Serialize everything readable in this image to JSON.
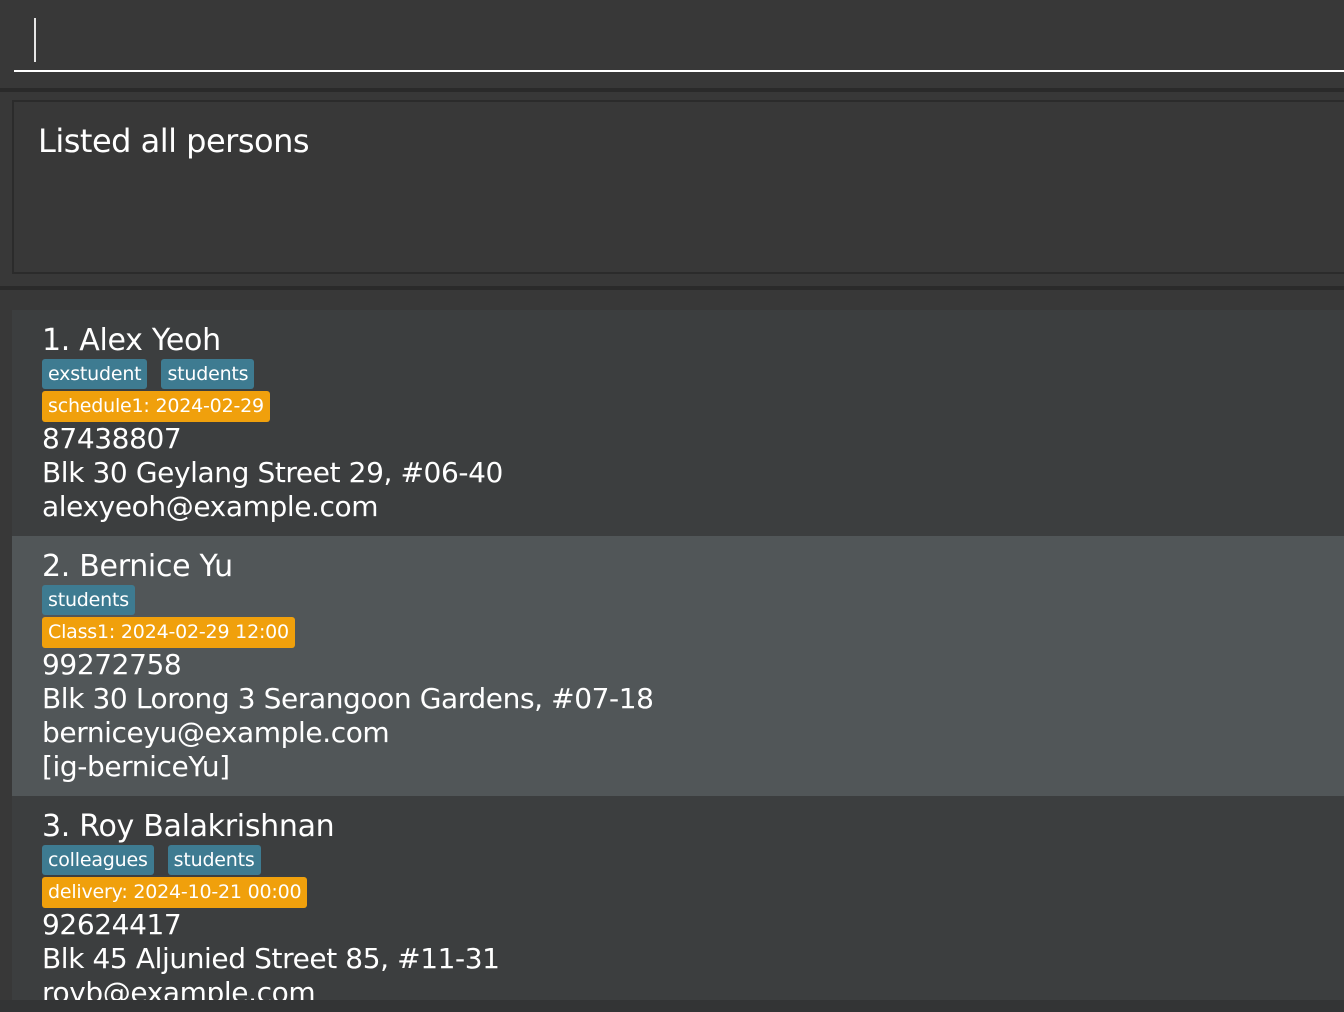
{
  "command_box": {
    "value": "",
    "placeholder": ""
  },
  "result_display": {
    "message": "Listed all persons"
  },
  "persons": [
    {
      "index_name": "1. Alex Yeoh",
      "tags": [
        "exstudent",
        "students"
      ],
      "schedule": "schedule1: 2024-02-29",
      "phone": "87438807",
      "address": "Blk 30 Geylang Street 29, #06-40",
      "email": "alexyeoh@example.com"
    },
    {
      "index_name": "2. Bernice Yu",
      "tags": [
        "students"
      ],
      "schedule": "Class1: 2024-02-29 12:00",
      "phone": "99272758",
      "address": "Blk 30 Lorong 3 Serangoon Gardens, #07-18",
      "email": "berniceyu@example.com",
      "social": "[ig-berniceYu]"
    },
    {
      "index_name": "3. Roy Balakrishnan",
      "tags": [
        "colleagues",
        "students"
      ],
      "schedule": "delivery: 2024-10-21 00:00",
      "phone": "92624417",
      "address": "Blk 45 Aljunied Street 85, #11-31",
      "email": "royb@example.com"
    }
  ],
  "colors": {
    "background": "#383838",
    "card_odd": "#3c3e3f",
    "card_selected": "#515658",
    "tag": "#3e7b91",
    "schedule": "#f0a00c",
    "text": "#ffffff"
  }
}
